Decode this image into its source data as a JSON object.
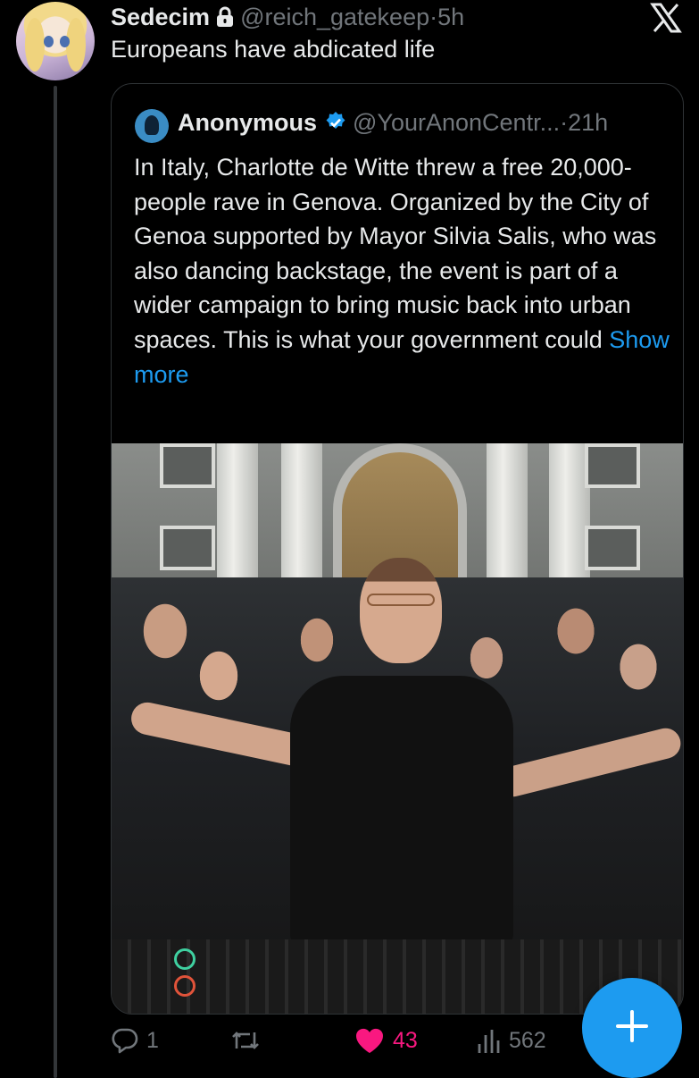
{
  "post": {
    "author_name": "Sedecim",
    "author_handle": "@reich_gatekeep",
    "separator": "·",
    "time": "5h",
    "text": "Europeans have abdicated life",
    "protected_icon": "lock-icon",
    "platform_icon": "x-logo-icon"
  },
  "quote": {
    "author_name": "Anonymous",
    "author_handle": "@YourAnonCentr...",
    "separator": "·",
    "time": "21h",
    "verified_icon": "verified-badge-icon",
    "text": "In Italy, Charlotte de Witte threw a free 20,000-people rave in Genova. Organized by the City of Genoa supported by Mayor Silvia Salis, who was also dancing backstage, the event is part of a wider campaign to bring music back into urban spaces. This is what your government could",
    "show_more": "Show more",
    "media_icon": "video-thumbnail"
  },
  "actions": {
    "replies": "1",
    "reposts": "",
    "likes": "43",
    "views": "562",
    "like_color": "#f91880"
  },
  "fab": {
    "icon": "plus-icon",
    "color": "#1d9bf0"
  }
}
